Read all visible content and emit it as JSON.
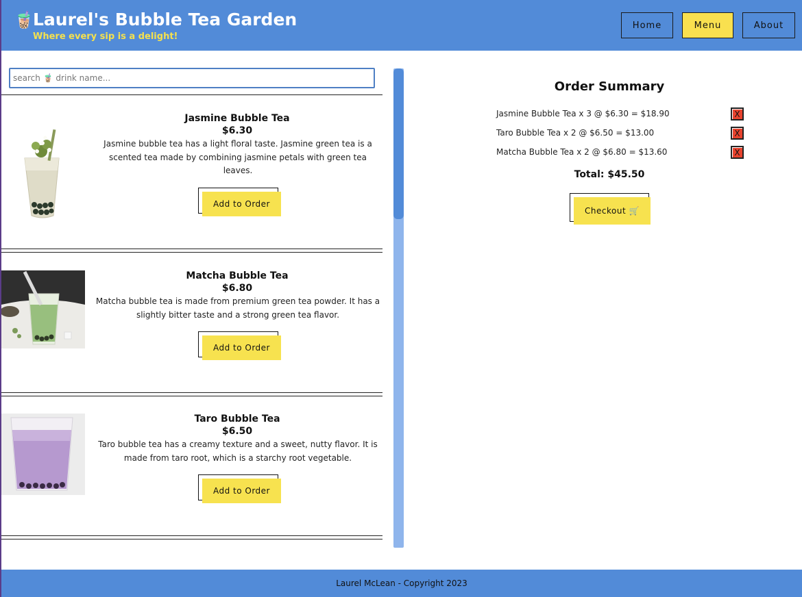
{
  "header": {
    "logo_icon": "🧋",
    "title": "Laurel's Bubble Tea Garden",
    "tagline": "Where every sip is a delight!",
    "nav": [
      {
        "label": "Home"
      },
      {
        "label": "Menu",
        "active": true
      },
      {
        "label": "About"
      }
    ]
  },
  "search": {
    "placeholder": "search 🧋 drink name...",
    "value": ""
  },
  "menu": {
    "add_label": "Add to Order",
    "items": [
      {
        "name": "Jasmine Bubble Tea",
        "price": "$6.30",
        "description": "Jasmine bubble tea has a light floral taste. Jasmine green tea is a scented tea made by combining jasmine petals with green tea leaves."
      },
      {
        "name": "Matcha Bubble Tea",
        "price": "$6.80",
        "description": "Matcha bubble tea is made from premium green tea powder. It has a slightly bitter taste and a strong green tea flavor."
      },
      {
        "name": "Taro Bubble Tea",
        "price": "$6.50",
        "description": "Taro bubble tea has a creamy texture and a sweet, nutty flavor. It is made from taro root, which is a starchy root vegetable."
      }
    ]
  },
  "order": {
    "title": "Order Summary",
    "lines": [
      {
        "text": "Jasmine Bubble Tea x 3 @ $6.30 = $18.90",
        "remove": "X"
      },
      {
        "text": "Taro Bubble Tea x 2 @ $6.50 = $13.00",
        "remove": "X"
      },
      {
        "text": "Matcha Bubble Tea x 2 @ $6.80 = $13.60",
        "remove": "X"
      }
    ],
    "total": "Total: $45.50",
    "checkout_label": "Checkout 🛒"
  },
  "footer": {
    "text": "Laurel McLean - Copyright 2023"
  },
  "colors": {
    "header_bg": "#528bd8",
    "accent_yellow": "#f7e24f",
    "remove_red": "#e8432e"
  }
}
